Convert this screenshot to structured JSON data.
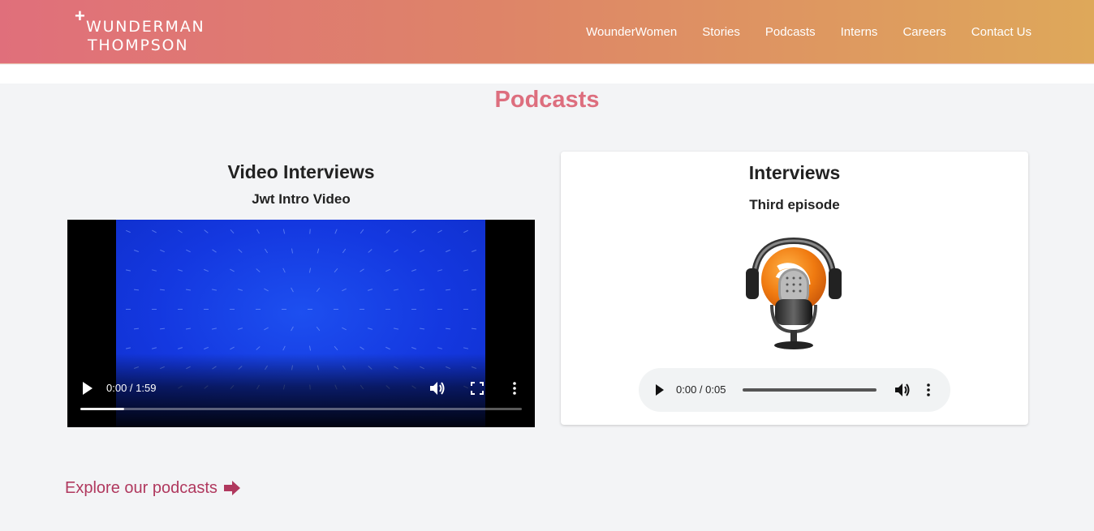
{
  "brand": {
    "line1": "WUNDERMAN",
    "line2": "THOMPSON",
    "plus": "+"
  },
  "nav": {
    "items": [
      {
        "label": "WounderWomen",
        "name": "nav-wounderwomen"
      },
      {
        "label": "Stories",
        "name": "nav-stories"
      },
      {
        "label": "Podcasts",
        "name": "nav-podcasts"
      },
      {
        "label": "Interns",
        "name": "nav-interns"
      },
      {
        "label": "Careers",
        "name": "nav-careers"
      },
      {
        "label": "Contact Us",
        "name": "nav-contact-us"
      }
    ]
  },
  "page": {
    "title": "Podcasts"
  },
  "video": {
    "heading": "Video Interviews",
    "subheading": "Jwt Intro Video",
    "time": "0:00 / 1:59",
    "progress": 0.1
  },
  "audio": {
    "heading": "Interviews",
    "subheading": "Third episode",
    "time": "0:00 / 0:05",
    "icon": "podcast-microphone-icon"
  },
  "explore": {
    "label": "Explore our podcasts",
    "icon": "arrow-right-icon"
  },
  "colors": {
    "header_gradient_start": "#e06f7b",
    "header_gradient_end": "#dea85a",
    "title": "#dd6e7e",
    "explore": "#b0385e",
    "page_background": "#f3f4f6"
  }
}
